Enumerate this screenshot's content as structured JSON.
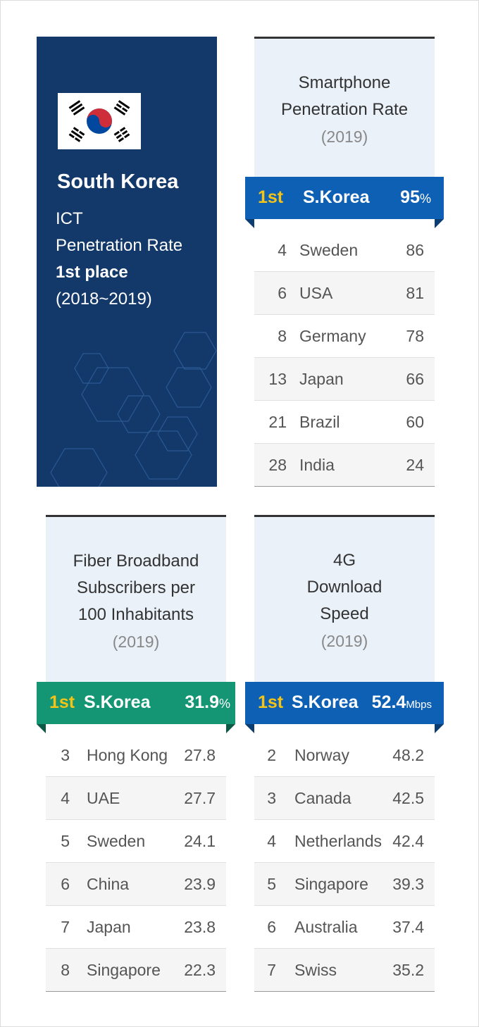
{
  "colors": {
    "navy": "#13386a",
    "blue_ribbon": "#0d60b3",
    "green_ribbon": "#149674",
    "gold": "#f3c317",
    "card_bg": "#eaf1f9"
  },
  "korea": {
    "flag_icon": "south-korea-flag-icon",
    "name": "South Korea",
    "lines": [
      "ICT",
      "Penetration Rate",
      "1st place",
      "(2018~2019)"
    ]
  },
  "chart_data": [
    {
      "type": "table",
      "title": [
        "Smartphone",
        "Penetration Rate"
      ],
      "year": "(2019)",
      "leader": {
        "rank": "1st",
        "country": "S.Korea",
        "value": "95",
        "unit": "%"
      },
      "rows": [
        {
          "rank": "4",
          "country": "Sweden",
          "value": "86"
        },
        {
          "rank": "6",
          "country": "USA",
          "value": "81"
        },
        {
          "rank": "8",
          "country": "Germany",
          "value": "78"
        },
        {
          "rank": "13",
          "country": "Japan",
          "value": "66"
        },
        {
          "rank": "21",
          "country": "Brazil",
          "value": "60"
        },
        {
          "rank": "28",
          "country": "India",
          "value": "24"
        }
      ]
    },
    {
      "type": "table",
      "title": [
        "Fiber Broadband",
        "Subscribers per",
        "100 Inhabitants"
      ],
      "year": "(2019)",
      "leader": {
        "rank": "1st",
        "country": "S.Korea",
        "value": "31.9",
        "unit": "%"
      },
      "rows": [
        {
          "rank": "3",
          "country": "Hong Kong",
          "value": "27.8"
        },
        {
          "rank": "4",
          "country": "UAE",
          "value": "27.7"
        },
        {
          "rank": "5",
          "country": "Sweden",
          "value": "24.1"
        },
        {
          "rank": "6",
          "country": "China",
          "value": "23.9"
        },
        {
          "rank": "7",
          "country": "Japan",
          "value": "23.8"
        },
        {
          "rank": "8",
          "country": "Singapore",
          "value": "22.3"
        }
      ]
    },
    {
      "type": "table",
      "title": [
        "4G",
        "Download",
        "Speed"
      ],
      "year": "(2019)",
      "leader": {
        "rank": "1st",
        "country": "S.Korea",
        "value": "52.4",
        "unit": "Mbps"
      },
      "rows": [
        {
          "rank": "2",
          "country": "Norway",
          "value": "48.2"
        },
        {
          "rank": "3",
          "country": "Canada",
          "value": "42.5"
        },
        {
          "rank": "4",
          "country": "Netherlands",
          "value": "42.4"
        },
        {
          "rank": "5",
          "country": "Singapore",
          "value": "39.3"
        },
        {
          "rank": "6",
          "country": "Australia",
          "value": "37.4"
        },
        {
          "rank": "7",
          "country": "Swiss",
          "value": "35.2"
        }
      ]
    }
  ]
}
